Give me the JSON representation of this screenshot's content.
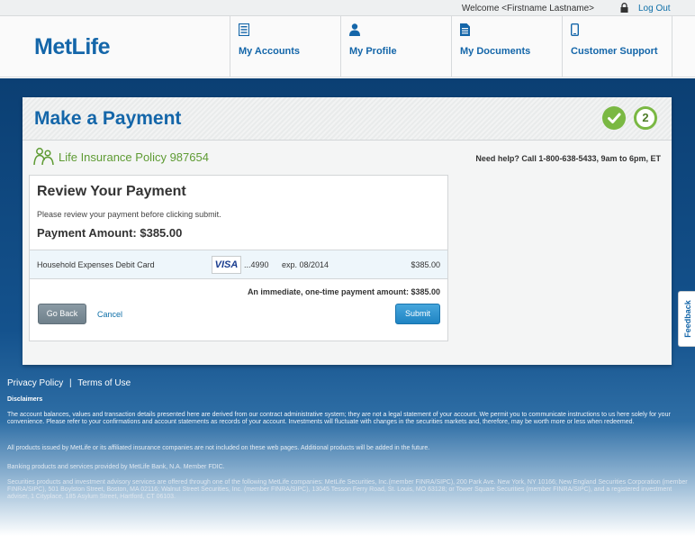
{
  "topbar": {
    "welcome": "Welcome <Firstname Lastname>",
    "logout": "Log Out",
    "lock_icon": "lock-icon"
  },
  "header": {
    "logo": "MetLife",
    "nav": [
      {
        "label": "My Accounts",
        "icon": "list-icon"
      },
      {
        "label": "My Profile",
        "icon": "person-icon"
      },
      {
        "label": "My Documents",
        "icon": "document-icon"
      },
      {
        "label": "Customer Support",
        "icon": "phone-icon"
      }
    ]
  },
  "payment": {
    "title": "Make a Payment",
    "steps": {
      "done_icon": "checkmark-icon",
      "current": "2"
    },
    "policy": "Life Insurance Policy 987654",
    "help": "Need help? Call 1-800-638-5433, 9am to 6pm, ET",
    "review_title": "Review Your Payment",
    "review_sub": "Please review your payment before clicking submit.",
    "amount_label": "Payment Amount: $385.00",
    "method": {
      "name": "Household Expenses Debit Card",
      "brand": "VISA",
      "number": "...4990",
      "expiry": "exp. 08/2014",
      "amount": "$385.00"
    },
    "onetime": "An immediate, one-time payment amount: $385.00",
    "go_back": "Go Back",
    "cancel": "Cancel",
    "submit": "Submit"
  },
  "feedback": "Feedback",
  "footer": {
    "privacy": "Privacy Policy",
    "separator": "|",
    "terms": "Terms of Use",
    "disclaimers_title": "Disclaimers",
    "p1": "The account balances, values and transaction details presented here are derived from our contract administrative system; they are not a legal statement of your account. We permit you to communicate instructions to us here solely for your convenience. Please refer to your confirmations and account statements as records of your account. Investments will fluctuate with changes in the securities markets and, therefore, may be worth more or less when redeemed.",
    "p2": "All products issued by MetLife or its affiliated insurance companies are not included on these web pages. Additional products will be added in the future.",
    "p3": "Banking products and services provided by MetLife Bank, N.A. Member FDIC.",
    "p4": "Securities products and investment advisory services are offered through one of the following MetLife companies: MetLife Securities, Inc.(member FINRA/SIPC), 200 Park Ave. New York, NY 10166; New England Securities Corporation (member FINRA/SIPC), 501 Boylston Street, Boston, MA 02116; Walnut Street Securities, Inc. (member FINRA/SIPC), 13045 Tesson Ferry Road, St. Louis, MO 63128; or Tower Square Securities (member FINRA/SIPC), and a registered investment adviser, 1 Cityplace, 185 Asylum Street, Hartford, CT 06103."
  }
}
